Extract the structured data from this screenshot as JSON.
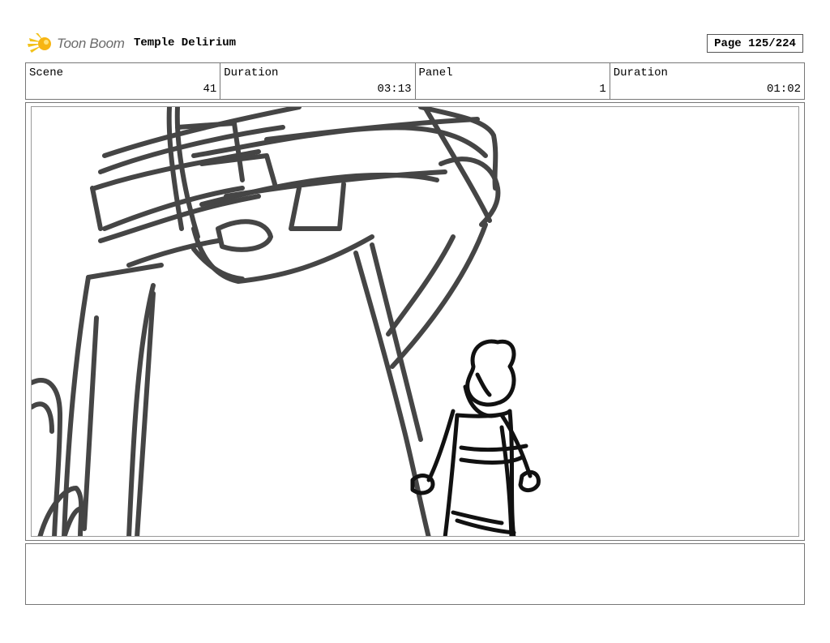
{
  "header": {
    "logo_text": "Toon Boom",
    "project_title": "Temple Delirium",
    "page_label": "Page 125/224"
  },
  "info": {
    "scene_label": "Scene",
    "scene_value": "41",
    "scene_duration_label": "Duration",
    "scene_duration_value": "03:13",
    "panel_label": "Panel",
    "panel_value": "1",
    "panel_duration_label": "Duration",
    "panel_duration_value": "01:02"
  },
  "panel": {
    "sketch_subjects": [
      "giant-figure-sketch",
      "small-character-sketch"
    ]
  },
  "notes": {
    "text": ""
  }
}
